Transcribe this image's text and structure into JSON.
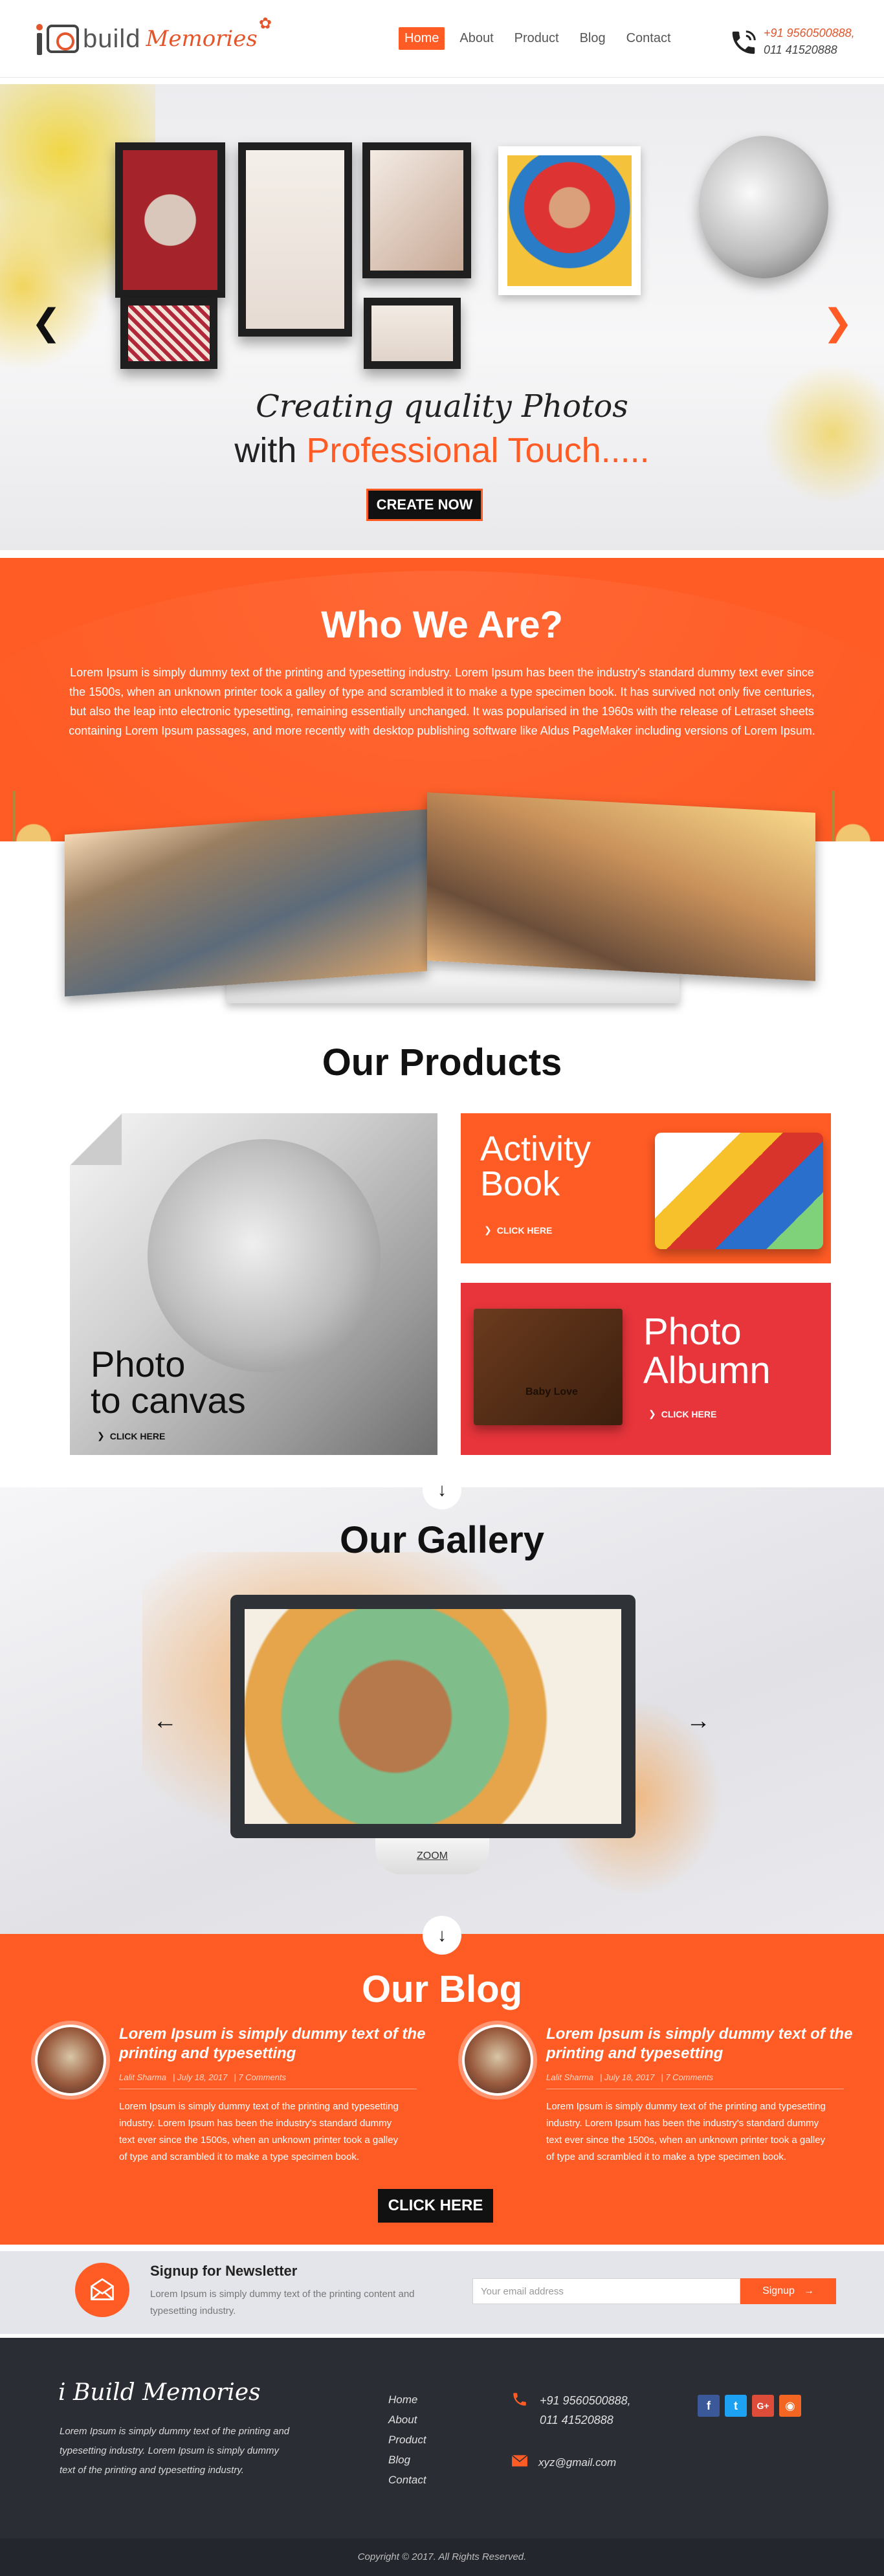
{
  "header": {
    "logo": {
      "prefix": "i",
      "build": "build",
      "memories": "Memories"
    },
    "nav": [
      {
        "label": "Home",
        "active": true
      },
      {
        "label": "About",
        "active": false
      },
      {
        "label": "Product",
        "active": false
      },
      {
        "label": "Blog",
        "active": false
      },
      {
        "label": "Contact",
        "active": false
      }
    ],
    "phone_line1": "+91 9560500888,",
    "phone_line2": "011 41520888"
  },
  "hero": {
    "title_line1": "Creating quality Photos",
    "title_line2_prefix": "with ",
    "title_line2_accent": "Professional Touch.....",
    "cta_label": "CREATE NOW",
    "prev_arrow": "❮",
    "next_arrow": "❯"
  },
  "who": {
    "title": "Who We Are?",
    "text": "Lorem Ipsum is simply dummy text of the printing and typesetting industry. Lorem Ipsum has been the industry's standard dummy text ever since the 1500s, when an unknown printer took a galley of type and scrambled it to make a type specimen book. It has survived not only five centuries, but also the leap into electronic typesetting, remaining essentially unchanged. It was popularised in the 1960s with the release of Letraset sheets containing Lorem Ipsum passages, and more recently with desktop publishing software like Aldus PageMaker including versions of Lorem Ipsum."
  },
  "products": {
    "title": "Our Products",
    "items": [
      {
        "title_line1": "Photo",
        "title_line2": "to canvas",
        "cta": "CLICK HERE"
      },
      {
        "title_line1": "Activity",
        "title_line2": "Book",
        "cta": "CLICK HERE"
      },
      {
        "title_line1": "Photo",
        "title_line2": "Albumn",
        "cta": "CLICK HERE",
        "book_label": "Baby Love"
      }
    ]
  },
  "gallery": {
    "title": "Our Gallery",
    "zoom_label": "ZOOM",
    "prev_arrow": "←",
    "next_arrow": "→",
    "down_arrow": "↓"
  },
  "blog": {
    "title": "Our Blog",
    "down_arrow": "↓",
    "posts": [
      {
        "title": "Lorem Ipsum is simply dummy text of the printing and typesetting",
        "author": "Lalit Sharma",
        "date": "July 18, 2017",
        "comments": "7 Comments",
        "body": "Lorem Ipsum is simply dummy text of the printing and typesetting industry. Lorem Ipsum has been the industry's standard dummy text ever since the 1500s, when an unknown printer took a galley of type and scrambled it to make a type specimen book."
      },
      {
        "title": "Lorem Ipsum is simply dummy text of the printing and typesetting",
        "author": "Lalit Sharma",
        "date": "July 18, 2017",
        "comments": "7 Comments",
        "body": "Lorem Ipsum is simply dummy text of the printing and typesetting industry. Lorem Ipsum has been the industry's standard dummy text ever since the 1500s, when an unknown printer took a galley of type and scrambled it to make a type specimen book."
      }
    ],
    "cta": "CLICK HERE"
  },
  "newsletter": {
    "title": "Signup for Newsletter",
    "text": "Lorem Ipsum is simply dummy text of the printing content and typesetting industry.",
    "placeholder": "Your email address",
    "button_label": "Signup",
    "button_arrow": "→"
  },
  "footer": {
    "logo": "i Build Memories",
    "about": "Lorem Ipsum is simply dummy text of the printing and typesetting industry. Lorem Ipsum is simply dummy text of the printing and typesetting industry.",
    "links": [
      "Home",
      "About",
      "Product",
      "Blog",
      "Contact"
    ],
    "phone_line1": "+91 9560500888,",
    "phone_line2": "011 41520888",
    "email": "xyz@gmail.com",
    "socials": [
      {
        "icon": "facebook-icon",
        "glyph": "f"
      },
      {
        "icon": "twitter-icon",
        "glyph": "t"
      },
      {
        "icon": "google-plus-icon",
        "glyph": "G+"
      },
      {
        "icon": "rss-icon",
        "glyph": "◉"
      }
    ],
    "copyright": "Copyright © 2017. All Rights Reserved."
  },
  "colors": {
    "accent": "#ff5b24",
    "red": "#e7353b",
    "dark": "#2b2d35"
  }
}
